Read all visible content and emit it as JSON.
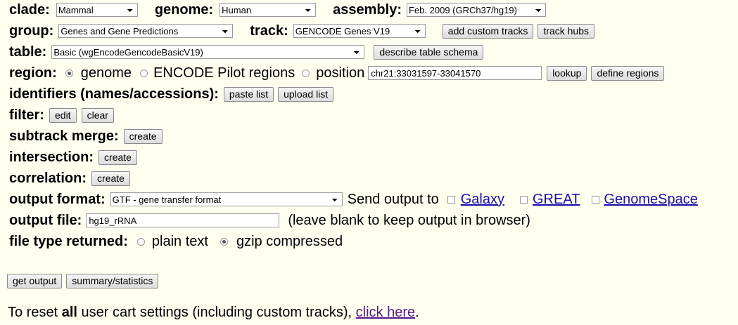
{
  "row1": {
    "clade_label": "clade:",
    "clade_value": "Mammal",
    "genome_label": "genome:",
    "genome_value": "Human",
    "assembly_label": "assembly:",
    "assembly_value": "Feb. 2009 (GRCh37/hg19)"
  },
  "row2": {
    "group_label": "group:",
    "group_value": "Genes and Gene Predictions",
    "track_label": "track:",
    "track_value": "GENCODE Genes V19",
    "add_custom_tracks": "add custom tracks",
    "track_hubs": "track hubs"
  },
  "row3": {
    "table_label": "table:",
    "table_value": "Basic (wgEncodeGencodeBasicV19)",
    "describe_schema": "describe table schema"
  },
  "region": {
    "label": "region:",
    "opt_genome": "genome",
    "opt_encode": "ENCODE Pilot regions",
    "opt_position": "position",
    "position_value": "chr21:33031597-33041570",
    "lookup": "lookup",
    "define_regions": "define regions",
    "selected": "genome"
  },
  "identifiers": {
    "label": "identifiers (names/accessions):",
    "paste_list": "paste list",
    "upload_list": "upload list"
  },
  "filter": {
    "label": "filter:",
    "edit": "edit",
    "clear": "clear"
  },
  "subtrack_merge": {
    "label": "subtrack merge:",
    "create": "create"
  },
  "intersection": {
    "label": "intersection:",
    "create": "create"
  },
  "correlation": {
    "label": "correlation:",
    "create": "create"
  },
  "output_format": {
    "label": "output format:",
    "value": "GTF - gene transfer format",
    "send_output_to": "Send output to",
    "galaxy": "Galaxy",
    "great": "GREAT",
    "genomespace": "GenomeSpace"
  },
  "output_file": {
    "label": "output file:",
    "value": "hg19_rRNA",
    "hint": "(leave blank to keep output in browser)"
  },
  "file_type": {
    "label": "file type returned:",
    "plain_text": "plain text",
    "gzip": "gzip compressed",
    "selected": "gzip compressed"
  },
  "actions": {
    "get_output": "get output",
    "summary": "summary/statistics"
  },
  "reset": {
    "prefix": "To reset ",
    "bold": "all",
    "middle": " user cart settings (including custom tracks), ",
    "link": "click here",
    "suffix": "."
  }
}
